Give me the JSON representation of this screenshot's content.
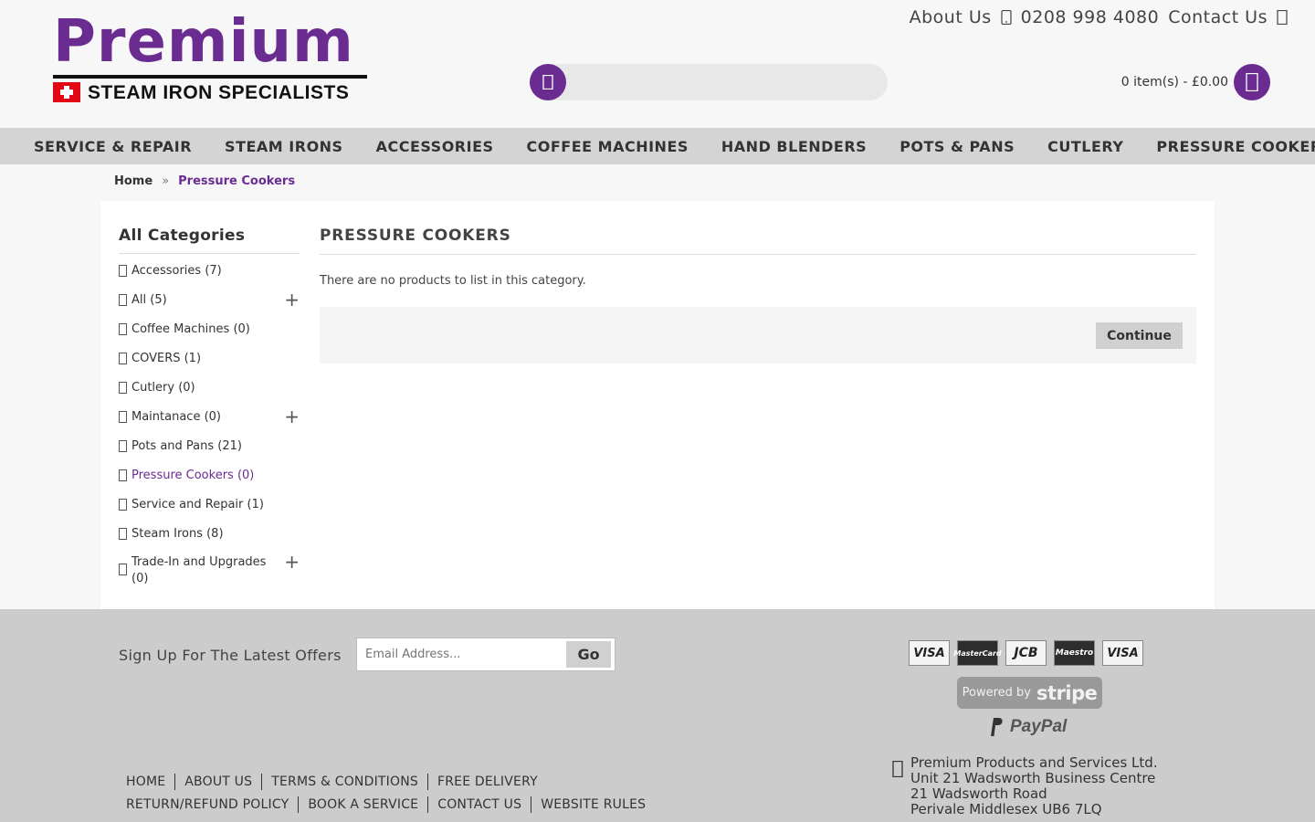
{
  "header": {
    "logo_word": "Premium",
    "logo_tagline": "STEAM IRON SPECIALISTS",
    "top_links": {
      "about": "About Us",
      "phone": "0208 998 4080",
      "contact": "Contact Us"
    },
    "search": {
      "placeholder": ""
    },
    "cart_summary": "0 item(s) - £0.00"
  },
  "nav": {
    "items": [
      "SERVICE & REPAIR",
      "STEAM IRONS",
      "ACCESSORIES",
      "COFFEE MACHINES",
      "HAND BLENDERS",
      "POTS & PANS",
      "CUTLERY",
      "PRESSURE COOKERS"
    ]
  },
  "breadcrumb": {
    "home": "Home",
    "separator": "»",
    "current": "Pressure Cookers"
  },
  "sidebar": {
    "title": "All Categories",
    "items": [
      {
        "label": "Accessories (7)"
      },
      {
        "label": "All (5)"
      },
      {
        "label": "Coffee Machines (0)"
      },
      {
        "label": "COVERS (1)"
      },
      {
        "label": "Cutlery (0)"
      },
      {
        "label": "Maintanace (0)"
      },
      {
        "label": "Pots and Pans (21)"
      },
      {
        "label": "Pressure Cookers (0)"
      },
      {
        "label": "Service and Repair (1)"
      },
      {
        "label": "Steam Irons (8)"
      },
      {
        "label": "Trade-In and Upgrades (0)"
      }
    ],
    "expand_symbol": "+"
  },
  "content": {
    "title": "PRESSURE COOKERS",
    "empty_message": "There are no products to list in this category.",
    "continue_label": "Continue"
  },
  "footer": {
    "signup_label": "Sign Up For The Latest Offers",
    "email_placeholder": "Email Address...",
    "go_label": "Go",
    "cards": [
      "VISA",
      "MasterCard",
      "JCB",
      "Maestro",
      "VISA"
    ],
    "stripe": {
      "prefix": "Powered by",
      "brand": "stripe"
    },
    "paypal": "PayPal",
    "links_row1": [
      "HOME",
      "ABOUT US",
      "TERMS & CONDITIONS",
      "FREE DELIVERY"
    ],
    "links_row2": [
      "RETURN/REFUND POLICY",
      "BOOK A SERVICE",
      "CONTACT US",
      "WEBSITE RULES"
    ],
    "address": [
      "Premium Products and Services Ltd.",
      "Unit 21 Wadsworth Business Centre",
      "21 Wadsworth Road",
      "Perivale Middlesex UB6 7LQ"
    ]
  },
  "colors": {
    "brand_purple": "#6b2c91",
    "nav_bg": "#d4d4d4",
    "footer_bg": "#cccccc"
  }
}
